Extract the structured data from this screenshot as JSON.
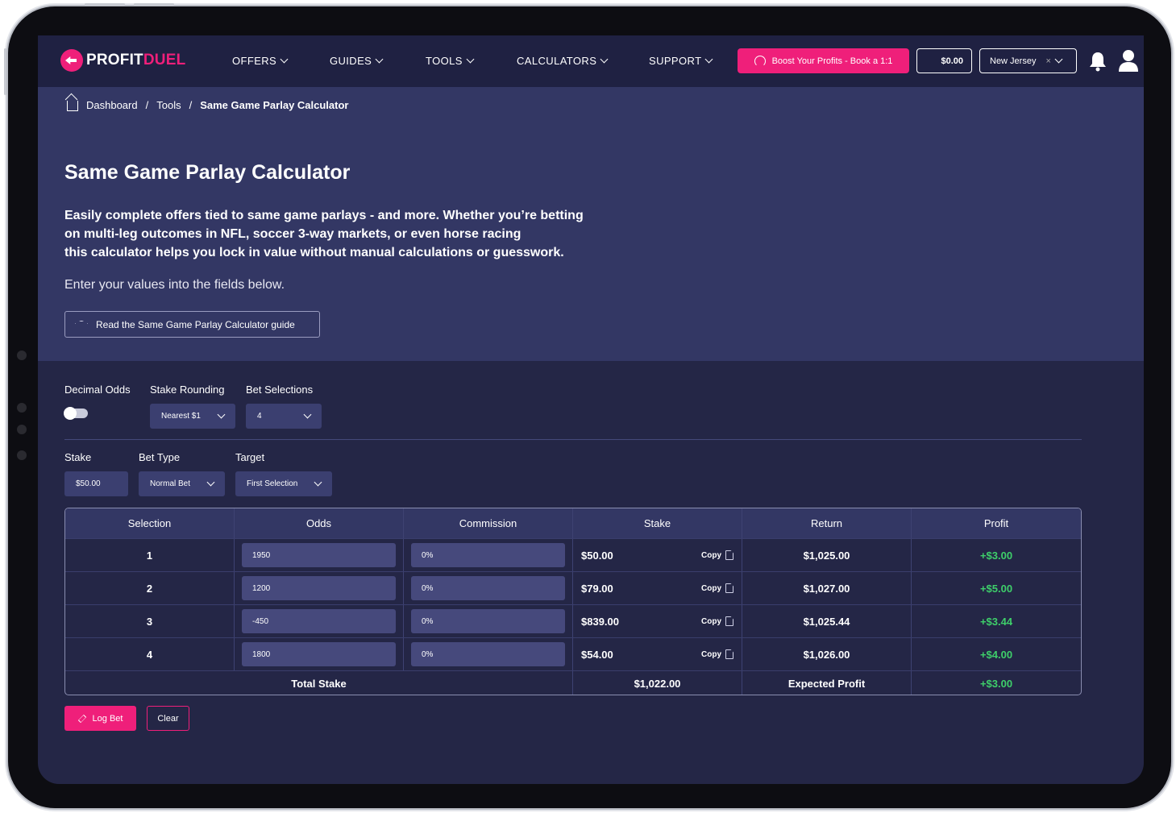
{
  "nav": {
    "logo_part1": "PROFIT",
    "logo_part2": "DUEL",
    "items": [
      "OFFERS",
      "GUIDES",
      "TOOLS",
      "CALCULATORS",
      "SUPPORT"
    ],
    "boost_label": "Boost Your Profits - Book a 1:1",
    "balance": "$0.00",
    "region": "New Jersey"
  },
  "breadcrumb": {
    "home": "Dashboard",
    "section": "Tools",
    "current": "Same Game Parlay Calculator"
  },
  "hero": {
    "title": "Same Game Parlay Calculator",
    "description_lines": [
      "Easily complete offers tied to same game parlays - and more. Whether you’re betting",
      "on multi-leg outcomes in NFL, soccer 3-way markets, or even horse racing",
      "this calculator helps you lock in value without manual calculations or guesswork."
    ],
    "subtext": "Enter your values into the fields below.",
    "guide_button": "Read the Same Game Parlay Calculator guide"
  },
  "controls": {
    "decimal_odds_label": "Decimal Odds",
    "decimal_odds_on": false,
    "stake_rounding_label": "Stake Rounding",
    "stake_rounding_value": "Nearest $1",
    "bet_selections_label": "Bet Selections",
    "bet_selections_value": "4",
    "stake_label": "Stake",
    "stake_value": "$50.00",
    "bet_type_label": "Bet Type",
    "bet_type_value": "Normal Bet",
    "target_label": "Target",
    "target_value": "First Selection"
  },
  "table": {
    "headers": [
      "Selection",
      "Odds",
      "Commission",
      "Stake",
      "Return",
      "Profit"
    ],
    "copy_label": "Copy",
    "rows": [
      {
        "selection": "1",
        "odds": "1950",
        "commission": "0%",
        "stake": "$50.00",
        "return": "$1,025.00",
        "profit": "+$3.00"
      },
      {
        "selection": "2",
        "odds": "1200",
        "commission": "0%",
        "stake": "$79.00",
        "return": "$1,027.00",
        "profit": "+$5.00"
      },
      {
        "selection": "3",
        "odds": "-450",
        "commission": "0%",
        "stake": "$839.00",
        "return": "$1,025.44",
        "profit": "+$3.44"
      },
      {
        "selection": "4",
        "odds": "1800",
        "commission": "0%",
        "stake": "$54.00",
        "return": "$1,026.00",
        "profit": "+$4.00"
      }
    ],
    "footer": {
      "total_stake_label": "Total Stake",
      "total_stake": "$1,022.00",
      "expected_profit_label": "Expected Profit",
      "expected_profit": "+$3.00"
    }
  },
  "actions": {
    "log_bet": "Log Bet",
    "clear": "Clear"
  },
  "colors": {
    "accent": "#ef1f7a",
    "profit": "#3ecf6a",
    "background": "#242646",
    "hero": "#333764"
  }
}
